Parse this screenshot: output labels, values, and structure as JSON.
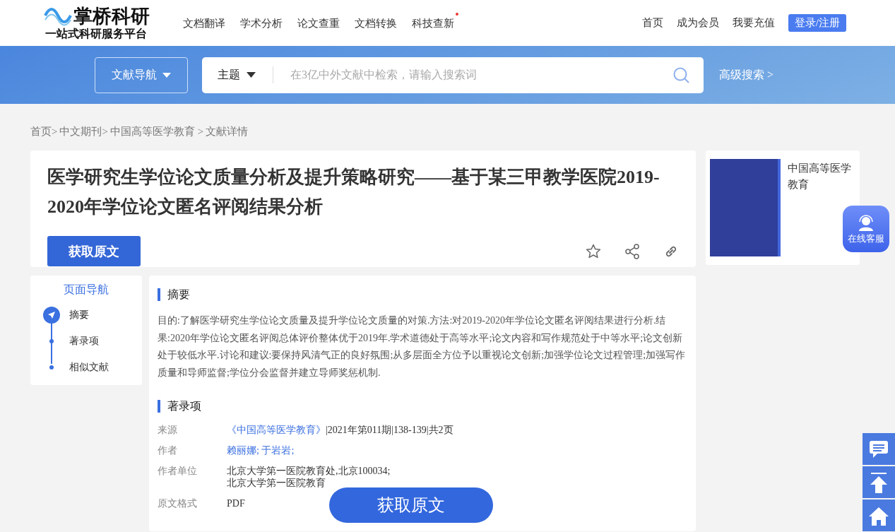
{
  "header": {
    "logo": {
      "name": "掌桥科研",
      "tagline": "一站式科研服务平台"
    },
    "nav": [
      {
        "label": "文档翻译",
        "dot": false
      },
      {
        "label": "学术分析",
        "dot": false
      },
      {
        "label": "论文查重",
        "dot": false
      },
      {
        "label": "文档转换",
        "dot": false
      },
      {
        "label": "科技查新",
        "dot": true
      }
    ],
    "links": [
      "首页",
      "成为会员",
      "我要充值"
    ],
    "login": "登录/注册"
  },
  "search": {
    "nav_button": "文献导航",
    "scope": "主题",
    "placeholder": "在3亿中外文献中检索，请输入搜索词",
    "advanced": "高级搜索 >"
  },
  "breadcrumb": [
    "首页>",
    "中文期刊>",
    "中国高等医学教育 >",
    "文献详情"
  ],
  "article": {
    "title": "医学研究生学位论文质量分析及提升策略研究——基于某三甲教学医院2019-2020年学位论文匿名评阅结果分析",
    "get_button": "获取原文"
  },
  "journal": {
    "name": "中国高等医学教育"
  },
  "page_nav": {
    "title": "页面导航",
    "items": [
      {
        "label": "摘要",
        "selected": true
      },
      {
        "label": "著录项",
        "selected": false
      },
      {
        "label": "相似文献",
        "selected": false
      }
    ]
  },
  "sections": [
    {
      "kind": "text",
      "heading": "摘要",
      "text": "目的:了解医学研究生学位论文质量及提升学位论文质量的对策.方法:对2019-2020年学位论文匿名评阅结果进行分析.结果:2020年学位论文匿名评阅总体评价整体优于2019年.学术道德处于高等水平;论文内容和写作规范处于中等水平;论文创新处于较低水平.讨论和建议:要保持风清气正的良好氛围;从多层面全方位予以重视论文创新;加强学位论文过程管理;加强写作质量和导师监督;学位分会监督并建立导师奖惩机制."
    },
    {
      "kind": "fields",
      "heading": "著录项",
      "fields": [
        {
          "label": "来源",
          "link": "《中国高等医学教育》",
          "value": "|2021年第011期|138-139|共2页"
        },
        {
          "label": "作者",
          "link": "赖丽娜; 于岩岩;"
        },
        {
          "label": "作者单位",
          "lines": [
            "北京大学第一医院教育处,北京100034;",
            "北京大学第一医院教育"
          ]
        },
        {
          "label": "原文格式",
          "value": "PDF"
        }
      ]
    }
  ],
  "float_get_button": "获取原文",
  "service_widget": "在线客服"
}
